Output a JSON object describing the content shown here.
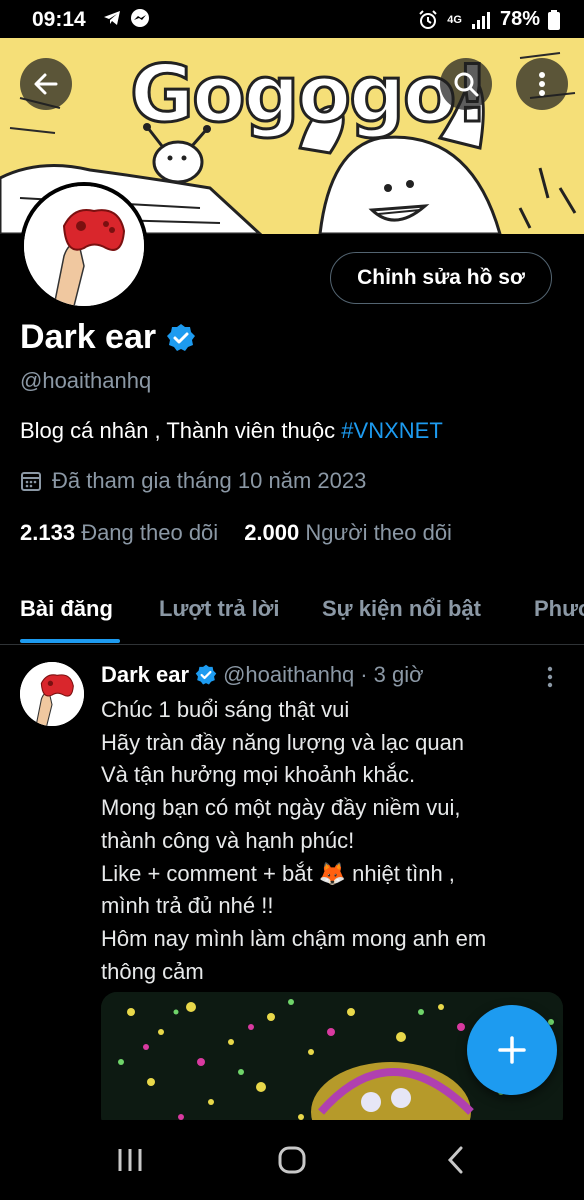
{
  "status_bar": {
    "time": "09:14",
    "battery": "78%",
    "network": "4G"
  },
  "banner": {
    "text": "Gogogo!"
  },
  "profile": {
    "edit_button": "Chỉnh sửa hồ sơ",
    "name": "Dark ear",
    "handle": "@hoaithanhq",
    "bio_text": "Blog cá nhân , Thành viên thuộc ",
    "bio_hashtag": "#VNXNET",
    "joined": "Đã tham gia tháng 10 năm 2023",
    "following_count": "2.133",
    "following_label": "Đang theo dõi",
    "followers_count": "2.000",
    "followers_label": "Người theo dõi"
  },
  "tabs": [
    {
      "label": "Bài đăng",
      "active": true
    },
    {
      "label": "Lượt trả lời",
      "active": false
    },
    {
      "label": "Sự kiện nổi bật",
      "active": false
    },
    {
      "label": "Phươ",
      "active": false
    }
  ],
  "post": {
    "author": "Dark ear",
    "handle": "@hoaithanhq",
    "separator": "·",
    "time": "3 giờ",
    "lines": [
      "Chúc 1 buổi sáng thật vui",
      "Hãy tràn đầy năng lượng và lạc quan",
      "Và tận hưởng mọi khoảnh khắc.",
      "Mong bạn có một ngày đầy niềm vui,",
      "thành công và hạnh phúc!",
      "Like + comment + bắt 🦊 nhiệt tình ,",
      "mình trả đủ nhé !!",
      "Hôm nay mình làm chậm mong anh em",
      "thông cảm"
    ]
  },
  "colors": {
    "accent": "#1d9bf0",
    "banner_bg": "#f5df78",
    "muted": "#8b98a5",
    "background": "#000000"
  },
  "icons": {
    "back": "arrow-left-icon",
    "search": "search-icon",
    "more": "more-vertical-icon",
    "verified": "verified-badge-icon",
    "calendar": "calendar-icon",
    "compose": "plus-icon",
    "nav_recents": "recents-icon",
    "nav_home": "home-icon",
    "nav_back": "chevron-left-icon"
  }
}
